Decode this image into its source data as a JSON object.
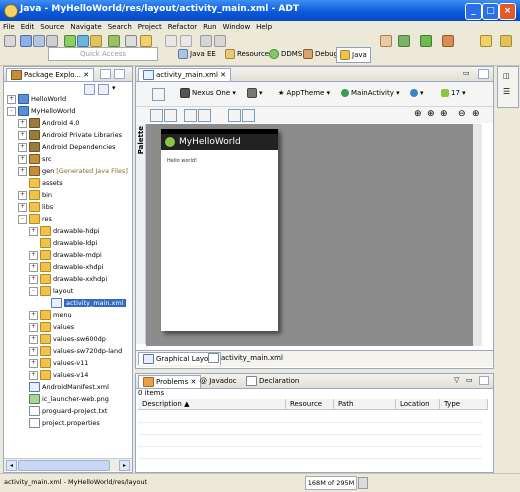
{
  "window": {
    "title": "Java - MyHelloWorld/res/layout/activity_main.xml - ADT"
  },
  "menu": [
    "File",
    "Edit",
    "Source",
    "Navigate",
    "Search",
    "Project",
    "Refactor",
    "Run",
    "Window",
    "Help"
  ],
  "toolbar": {
    "quick_access_placeholder": "Quick Access",
    "perspectives": [
      "Java EE",
      "Resource",
      "DDMS",
      "Debug",
      "Java"
    ]
  },
  "explorer": {
    "title": "Package Explo...",
    "items": [
      {
        "label": "HelloWorld",
        "icon": "project-icon",
        "depth": 0,
        "tw": "+"
      },
      {
        "label": "MyHelloWorld",
        "icon": "project-icon",
        "depth": 0,
        "tw": "-"
      },
      {
        "label": "Android 4.0",
        "icon": "library-icon",
        "depth": 1,
        "tw": "+"
      },
      {
        "label": "Android Private Libraries",
        "icon": "library-icon",
        "depth": 1,
        "tw": "+"
      },
      {
        "label": "Android Dependencies",
        "icon": "library-icon",
        "depth": 1,
        "tw": "+"
      },
      {
        "label": "src",
        "icon": "package-folder-icon",
        "depth": 1,
        "tw": "+"
      },
      {
        "label": "gen",
        "suffix": "[Generated Java Files]",
        "icon": "package-folder-icon",
        "depth": 1,
        "tw": "+"
      },
      {
        "label": "assets",
        "icon": "folder-icon",
        "depth": 1,
        "tw": ""
      },
      {
        "label": "bin",
        "icon": "folder-icon",
        "depth": 1,
        "tw": "+"
      },
      {
        "label": "libs",
        "icon": "folder-icon",
        "depth": 1,
        "tw": "+"
      },
      {
        "label": "res",
        "icon": "folder-icon",
        "depth": 1,
        "tw": "-"
      },
      {
        "label": "drawable-hdpi",
        "icon": "folder-icon",
        "depth": 2,
        "tw": "+"
      },
      {
        "label": "drawable-ldpi",
        "icon": "folder-icon",
        "depth": 2,
        "tw": ""
      },
      {
        "label": "drawable-mdpi",
        "icon": "folder-icon",
        "depth": 2,
        "tw": "+"
      },
      {
        "label": "drawable-xhdpi",
        "icon": "folder-icon",
        "depth": 2,
        "tw": "+"
      },
      {
        "label": "drawable-xxhdpi",
        "icon": "folder-icon",
        "depth": 2,
        "tw": "+"
      },
      {
        "label": "layout",
        "icon": "folder-icon",
        "depth": 2,
        "tw": "-"
      },
      {
        "label": "activity_main.xml",
        "icon": "xml-file-icon",
        "depth": 3,
        "tw": "",
        "selected": true
      },
      {
        "label": "menu",
        "icon": "folder-icon",
        "depth": 2,
        "tw": "+"
      },
      {
        "label": "values",
        "icon": "folder-icon",
        "depth": 2,
        "tw": "+"
      },
      {
        "label": "values-sw600dp",
        "icon": "folder-icon",
        "depth": 2,
        "tw": "+"
      },
      {
        "label": "values-sw720dp-land",
        "icon": "folder-icon",
        "depth": 2,
        "tw": "+"
      },
      {
        "label": "values-v11",
        "icon": "folder-icon",
        "depth": 2,
        "tw": "+"
      },
      {
        "label": "values-v14",
        "icon": "folder-icon",
        "depth": 2,
        "tw": "+"
      },
      {
        "label": "AndroidManifest.xml",
        "icon": "xml-file-icon",
        "depth": 1,
        "tw": ""
      },
      {
        "label": "ic_launcher-web.png",
        "icon": "image-file-icon",
        "depth": 1,
        "tw": ""
      },
      {
        "label": "proguard-project.txt",
        "icon": "text-file-icon",
        "depth": 1,
        "tw": ""
      },
      {
        "label": "project.properties",
        "icon": "text-file-icon",
        "depth": 1,
        "tw": ""
      }
    ]
  },
  "editor": {
    "tab_title": "activity_main.xml",
    "device": "Nexus One",
    "theme": "AppTheme",
    "activity": "MainActivity",
    "api_level": "17",
    "palette_label": "Palette",
    "app_title": "MyHelloWorld",
    "hello_text": "Hello world!",
    "bottom_tabs": [
      "Graphical Layout",
      "activity_main.xml"
    ]
  },
  "problems": {
    "tabs": [
      "Problems",
      "Javadoc",
      "Declaration"
    ],
    "count": "0 items",
    "columns": [
      "Description",
      "Resource",
      "Path",
      "Location",
      "Type"
    ]
  },
  "status": {
    "selection": "activity_main.xml - MyHelloWorld/res/layout",
    "memory": "168M of 295M"
  },
  "colors": {
    "titlebar": "#0a58d8",
    "selection": "#316ac5",
    "android_actionbar": "#222222"
  }
}
